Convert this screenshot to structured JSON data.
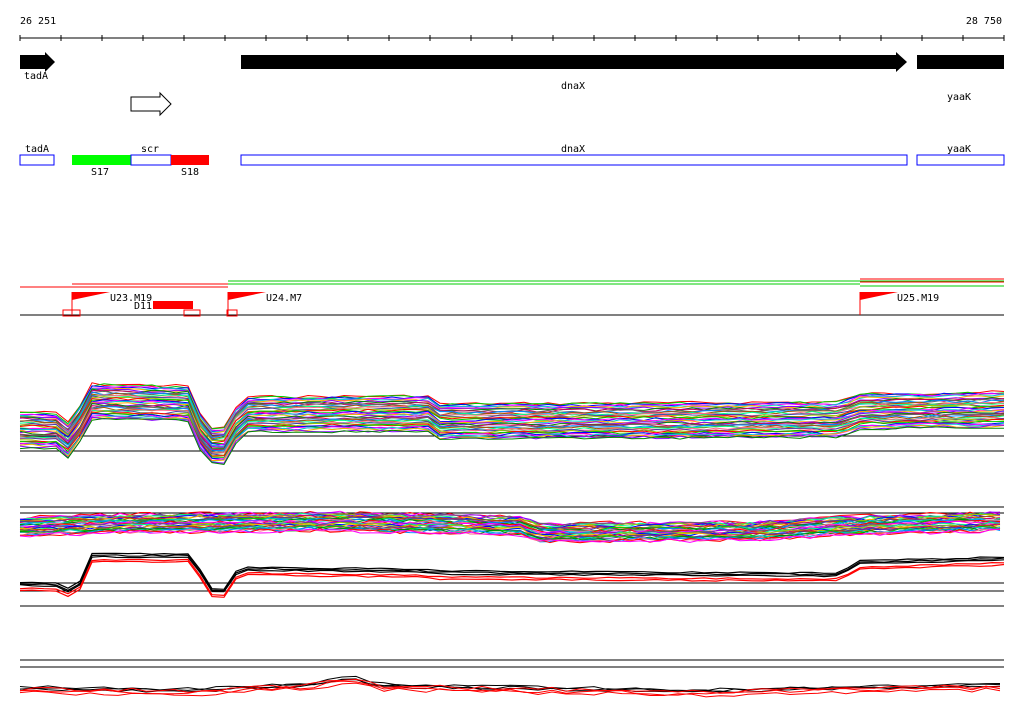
{
  "ruler": {
    "start": "26 251",
    "end": "28 750"
  },
  "genes": [
    {
      "name": "tadA",
      "strand": "+",
      "style": "filled"
    },
    {
      "name": "",
      "strand": "+",
      "style": "outline"
    },
    {
      "name": "dnaX",
      "strand": "+",
      "style": "filled"
    },
    {
      "name": "yaaK",
      "strand": "+",
      "style": "filled"
    }
  ],
  "regions": [
    {
      "label": "tadA"
    },
    {
      "label": "scr",
      "segments": [
        {
          "label": "S17",
          "color": "#00ff00"
        },
        {
          "label": "",
          "color": "#ffffff"
        },
        {
          "label": "S18",
          "color": "#ff0000"
        }
      ]
    },
    {
      "label": "dnaX"
    },
    {
      "label": "yaaK"
    }
  ],
  "features": {
    "promoters": [
      {
        "label": "U23.M19"
      },
      {
        "label": "U24.M7"
      },
      {
        "label": "U25.M19"
      }
    ],
    "deletion": {
      "label": "D11",
      "color": "#ff0000"
    }
  },
  "colors": {
    "gene_fill": "#000000",
    "region_border": "#0000ff",
    "promoter_flag": "#ff0000",
    "track_green": "#00cc00",
    "track_red": "#ff0000"
  }
}
